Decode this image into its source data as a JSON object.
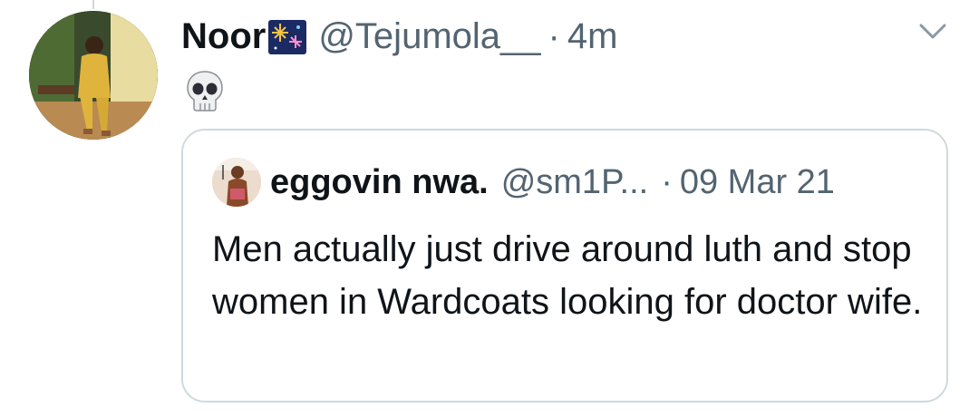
{
  "tweet": {
    "display_name": "Noor",
    "name_badge_icon": "fireworks-emoji-icon",
    "handle": "@Tejumola__",
    "separator": "·",
    "time": "4m",
    "body_emoji_icon": "skull-emoji-icon",
    "menu_icon": "chevron-down-icon"
  },
  "quoted_tweet": {
    "display_name": "eggovin nwa.",
    "handle": "@sm1P...",
    "separator": "·",
    "date": "09 Mar 21",
    "text": "Men actually just drive around luth and stop women in Wardcoats looking for doctor wife."
  },
  "colors": {
    "text_primary": "#0f1419",
    "text_secondary": "#536471",
    "border": "#cfd9de"
  }
}
